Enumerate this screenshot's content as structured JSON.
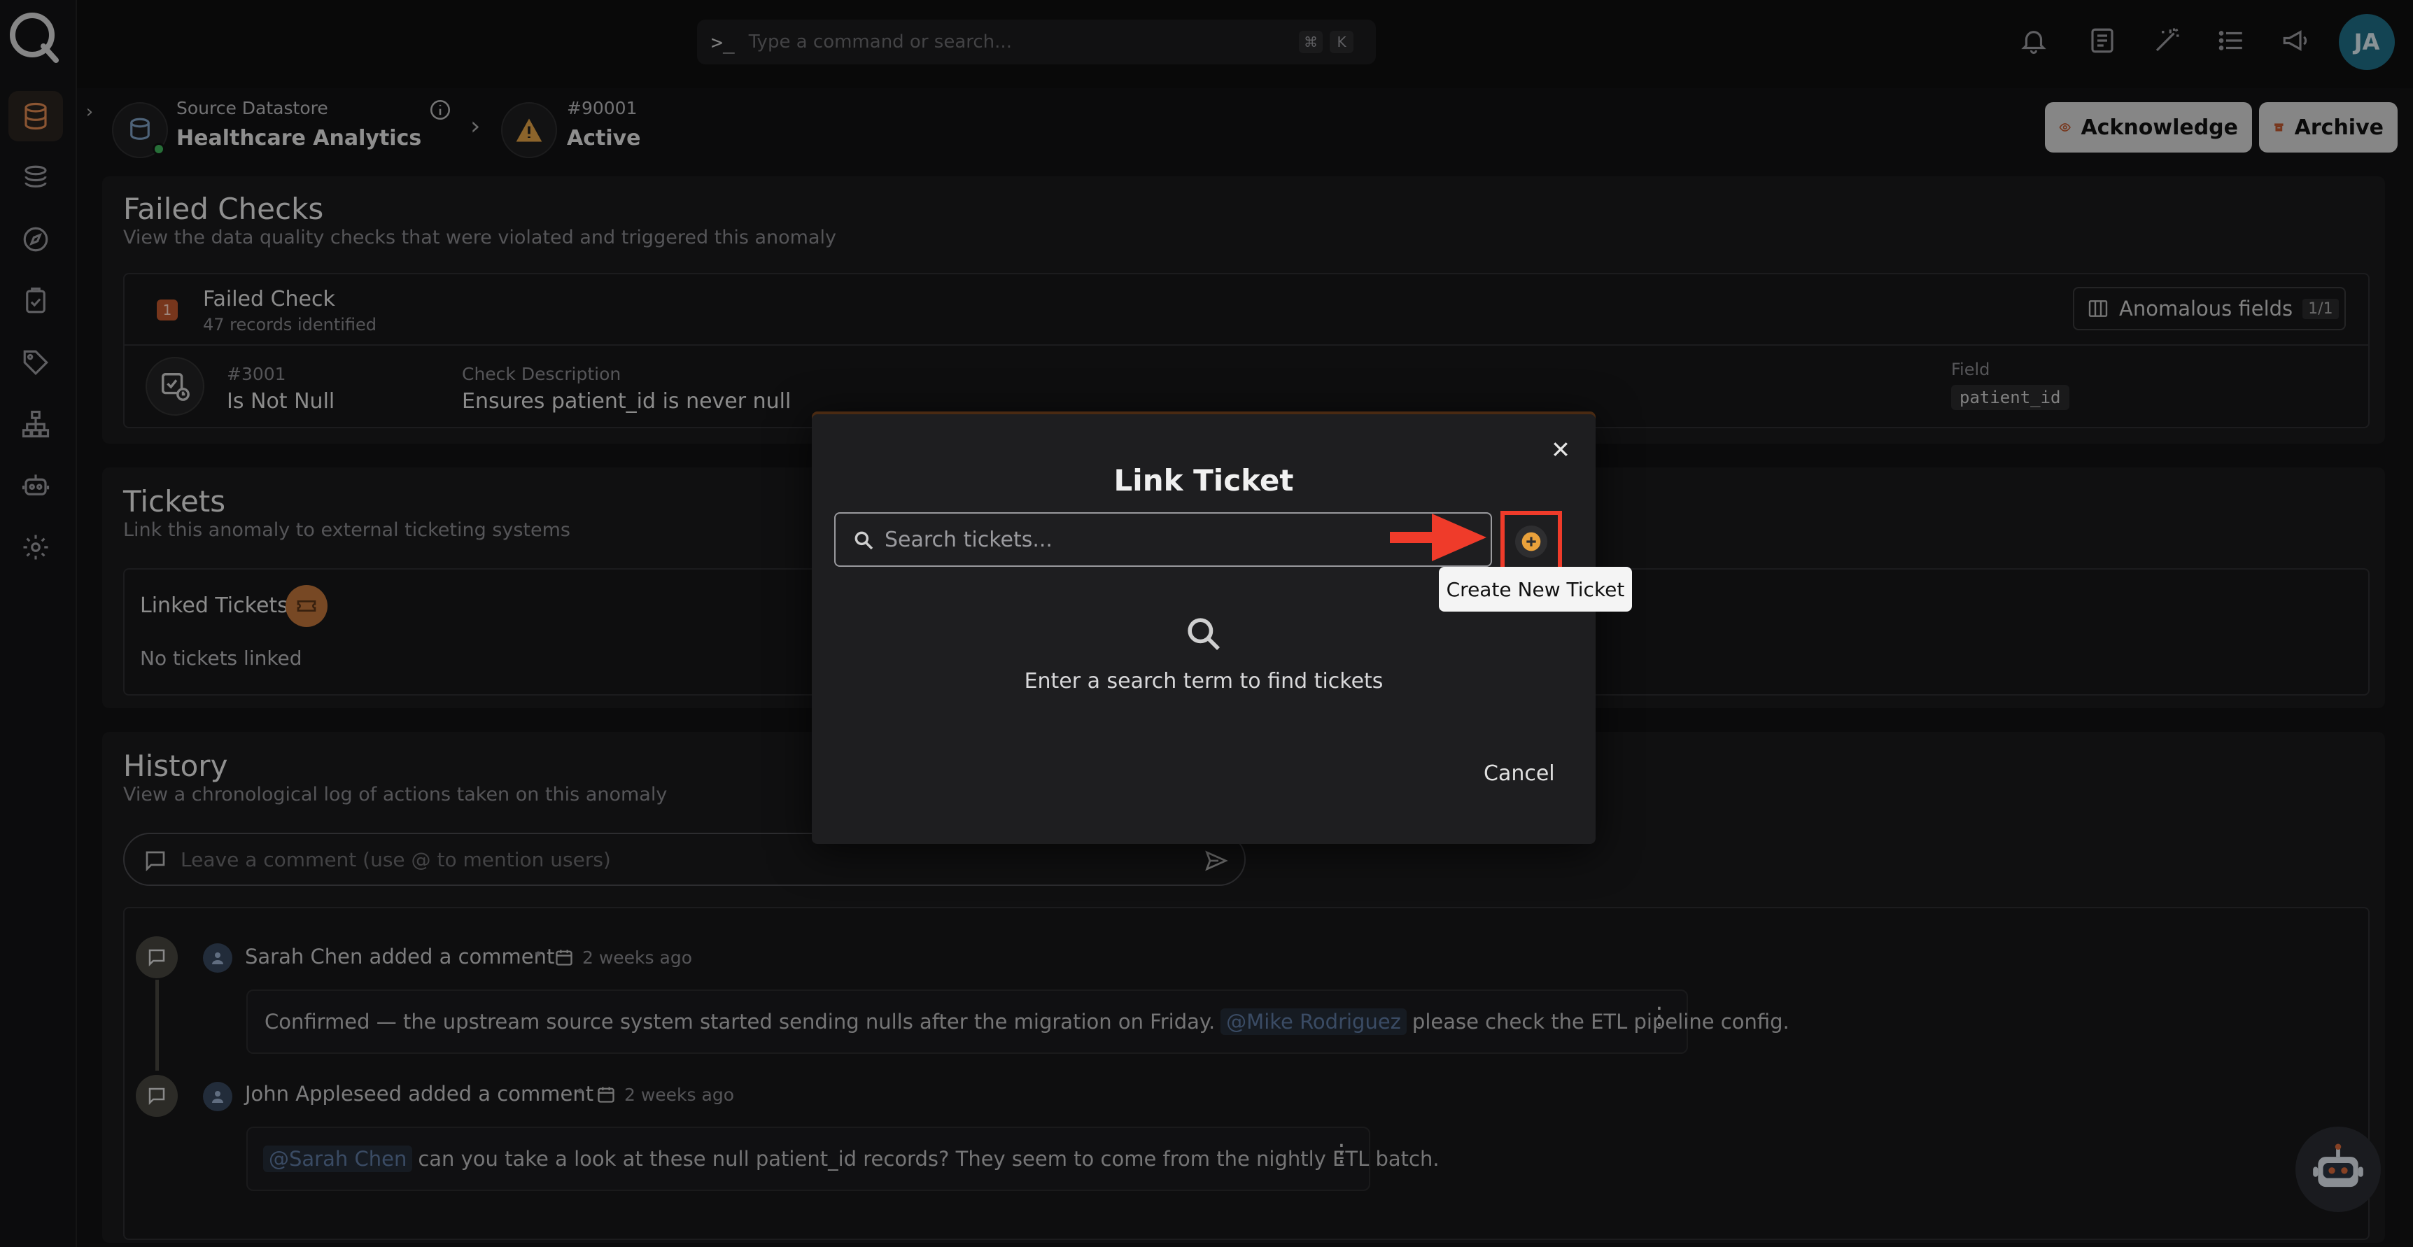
{
  "command_bar": {
    "placeholder": "Type a command or search...",
    "shortcut_mod": "⌘",
    "shortcut_key": "K"
  },
  "user": {
    "initials": "JA"
  },
  "breadcrumb": {
    "datastore_label": "Source Datastore",
    "datastore_name": "Healthcare Analytics",
    "anomaly_id": "#90001",
    "anomaly_status": "Active"
  },
  "actions": {
    "acknowledge": "Acknowledge",
    "archive": "Archive"
  },
  "failed_checks": {
    "title": "Failed Checks",
    "subtitle": "View the data quality checks that were violated and triggered this anomaly",
    "count": "1",
    "header_label": "Failed Check",
    "records": "47 records identified",
    "anomalous_fields_label": "Anomalous fields",
    "anomalous_fields_count": "1/1",
    "check": {
      "id": "#3001",
      "name": "Is Not Null",
      "description_label": "Check Description",
      "description": "Ensures patient_id is never null",
      "field_label": "Field",
      "field": "patient_id"
    }
  },
  "tickets": {
    "title": "Tickets",
    "subtitle": "Link this anomaly to external ticketing systems",
    "linked_label": "Linked Tickets",
    "empty": "No tickets linked"
  },
  "history": {
    "title": "History",
    "subtitle": "View a chronological log of actions taken on this anomaly",
    "comment_placeholder": "Leave a comment (use @ to mention users)",
    "entries": [
      {
        "author": "Sarah Chen",
        "action": "added a comment",
        "time": "2 weeks ago",
        "text_before": "Confirmed — the upstream source system started sending nulls after the migration on Friday.",
        "mention": "@Mike Rodriguez",
        "text_after": "please check the ETL pipeline config."
      },
      {
        "author": "John Appleseed",
        "action": "added a comment",
        "time": "2 weeks ago",
        "mention": "@Sarah Chen",
        "text_after": "can you take a look at these null patient_id records? They seem to come from the nightly ETL batch."
      }
    ]
  },
  "modal": {
    "title": "Link Ticket",
    "search_placeholder": "Search tickets...",
    "tooltip": "Create New Ticket",
    "empty_text": "Enter a search term to find tickets",
    "cancel": "Cancel"
  },
  "colors": {
    "accent": "#c0572e",
    "highlight": "#ef3b2a",
    "avatar": "#1f6e86"
  }
}
